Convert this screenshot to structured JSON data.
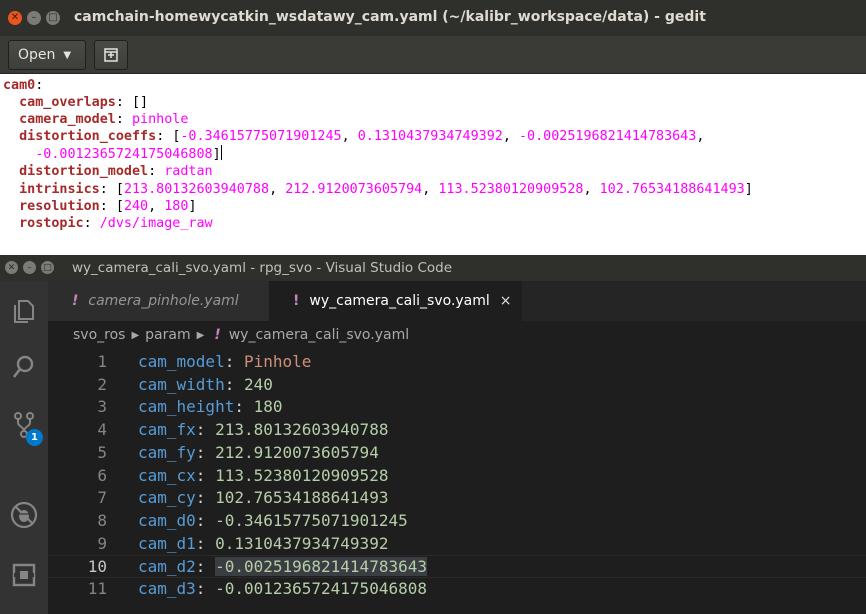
{
  "gedit": {
    "title": "camchain-homewycatkin_wsdatawy_cam.yaml (~/kalibr_workspace/data) - gedit",
    "open_label": "Open",
    "lines": [
      {
        "key": "cam0",
        "sep": ":",
        "val": ""
      },
      {
        "key": "  cam_overlaps",
        "sep": ": ",
        "val": "[]",
        "valClass": "g-txt"
      },
      {
        "key": "  camera_model",
        "sep": ": ",
        "val": "pinhole"
      },
      {
        "key": "  distortion_coeffs",
        "sep": ": ",
        "val": "[-0.34615775071901245, 0.1310437934749392, -0.0025196821414783643,",
        "bracket": true
      },
      {
        "key": "",
        "sep": "",
        "val": "    -0.0012365724175046808]",
        "cont": true
      },
      {
        "key": "  distortion_model",
        "sep": ": ",
        "val": "radtan"
      },
      {
        "key": "  intrinsics",
        "sep": ": ",
        "val": "[213.80132603940788, 212.9120073605794, 113.52380120909528, 102.76534188641493]",
        "bracket": true
      },
      {
        "key": "  resolution",
        "sep": ": ",
        "val": "[240, 180]",
        "bracket": true
      },
      {
        "key": "  rostopic",
        "sep": ": ",
        "val": "/dvs/image_raw"
      }
    ]
  },
  "vscode": {
    "title": "wy_camera_cali_svo.yaml - rpg_svo - Visual Studio Code",
    "scm_badge": "1",
    "tabs": [
      {
        "label": "camera_pinhole.yaml",
        "active": false
      },
      {
        "label": "wy_camera_cali_svo.yaml",
        "active": true,
        "close": "×"
      }
    ],
    "breadcrumb": [
      "svo_ros",
      "param",
      "wy_camera_cali_svo.yaml"
    ],
    "active_line": 10,
    "lines": [
      {
        "num": "1",
        "key": "cam_model",
        "val": "Pinhole",
        "type": "s"
      },
      {
        "num": "2",
        "key": "cam_width",
        "val": "240",
        "type": "n"
      },
      {
        "num": "3",
        "key": "cam_height",
        "val": "180",
        "type": "n"
      },
      {
        "num": "4",
        "key": "cam_fx",
        "val": "213.80132603940788",
        "type": "n"
      },
      {
        "num": "5",
        "key": "cam_fy",
        "val": "212.9120073605794",
        "type": "n"
      },
      {
        "num": "6",
        "key": "cam_cx",
        "val": "113.52380120909528",
        "type": "n"
      },
      {
        "num": "7",
        "key": "cam_cy",
        "val": "102.76534188641493",
        "type": "n"
      },
      {
        "num": "8",
        "key": "cam_d0",
        "val": "-0.34615775071901245",
        "type": "n"
      },
      {
        "num": "9",
        "key": "cam_d1",
        "val": "0.1310437934749392",
        "type": "n"
      },
      {
        "num": "10",
        "key": "cam_d2",
        "val": "-0.0025196821414783643",
        "type": "n"
      },
      {
        "num": "11",
        "key": "cam_d3",
        "val": "-0.0012365724175046808",
        "type": "n"
      }
    ]
  },
  "colors": {
    "gedit_key": "#a52a2a",
    "gedit_value": "#ff00ff",
    "vscode_key": "#569cd6",
    "vscode_string": "#ce9178",
    "vscode_number": "#b5cea8",
    "accent": "#007acc",
    "ubuntu_close": "#e9541f"
  },
  "icons": {
    "activity": [
      "explorer-icon",
      "search-icon",
      "source-control-icon",
      "debug-icon",
      "extensions-icon"
    ]
  }
}
